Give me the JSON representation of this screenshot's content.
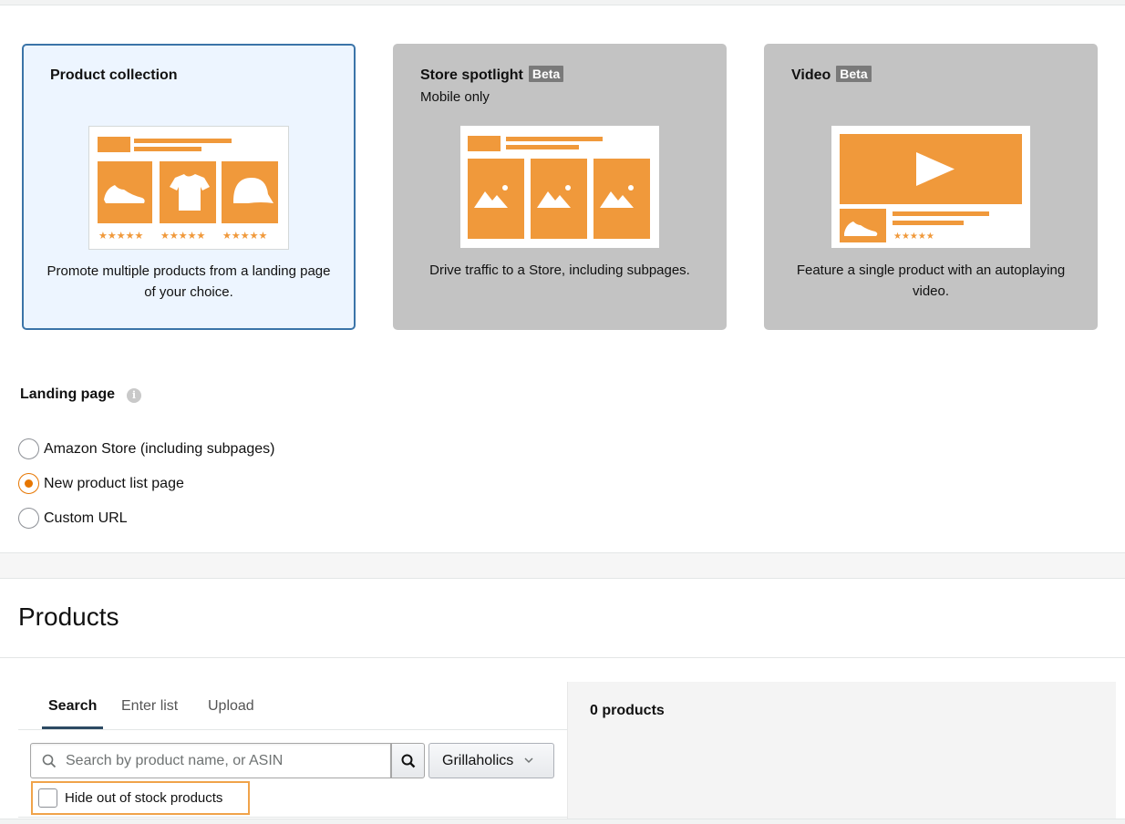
{
  "ad_formats": [
    {
      "title": "Product collection",
      "badge": "",
      "subtitle": "",
      "description": "Promote multiple products from a landing page of your choice.",
      "selected": true
    },
    {
      "title": "Store spotlight",
      "badge": "Beta",
      "subtitle": "Mobile only",
      "description": "Drive traffic to a Store, including subpages.",
      "selected": false
    },
    {
      "title": "Video",
      "badge": "Beta",
      "subtitle": "",
      "description": "Feature a single product with an autoplaying video.",
      "selected": false
    }
  ],
  "colors": {
    "accent_orange": "#f0993b",
    "selected_border": "#3b74a8",
    "radio_checked": "#e77600"
  },
  "landing_page": {
    "label": "Landing page",
    "info_icon": "i",
    "options": [
      {
        "label": "Amazon Store (including subpages)",
        "checked": false
      },
      {
        "label": "New product list page",
        "checked": true
      },
      {
        "label": "Custom URL",
        "checked": false
      }
    ]
  },
  "products": {
    "title": "Products",
    "tabs": [
      "Search",
      "Enter list",
      "Upload"
    ],
    "active_tab": "Search",
    "search_placeholder": "Search by product name, or ASIN",
    "search_value": "",
    "brand_selected": "Grillaholics",
    "hide_out_of_stock_label": "Hide out of stock products",
    "hide_out_of_stock_checked": false,
    "count_label": "0 products"
  },
  "icons": [
    "info-icon",
    "search-icon",
    "chevron-down-icon",
    "shoe-icon",
    "tshirt-icon",
    "cap-icon",
    "image-placeholder-icon",
    "play-icon",
    "star-icon"
  ]
}
